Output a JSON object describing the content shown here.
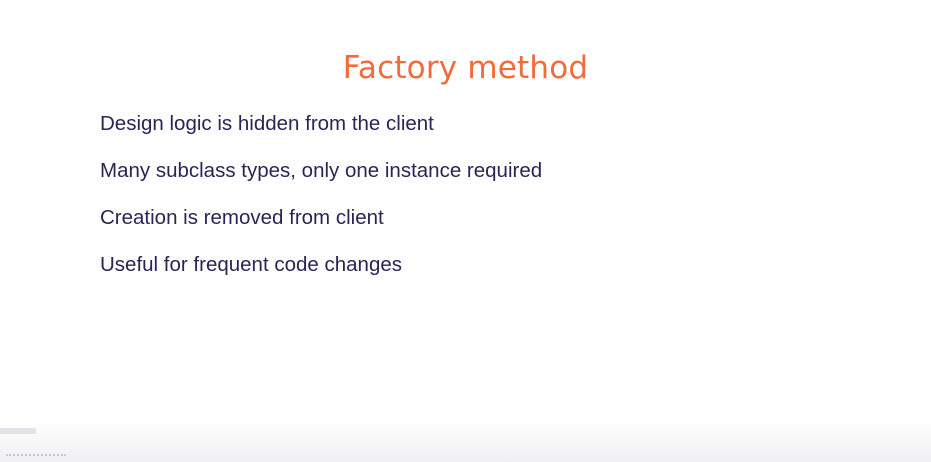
{
  "slide": {
    "title": "Factory method",
    "bullets": [
      "Design logic is hidden from the client",
      "Many subclass types, only one instance required",
      "Creation is removed from client",
      "Useful for frequent code changes"
    ]
  },
  "colors": {
    "title": "#f26b3a",
    "text": "#2b2457",
    "background": "#ffffff"
  }
}
